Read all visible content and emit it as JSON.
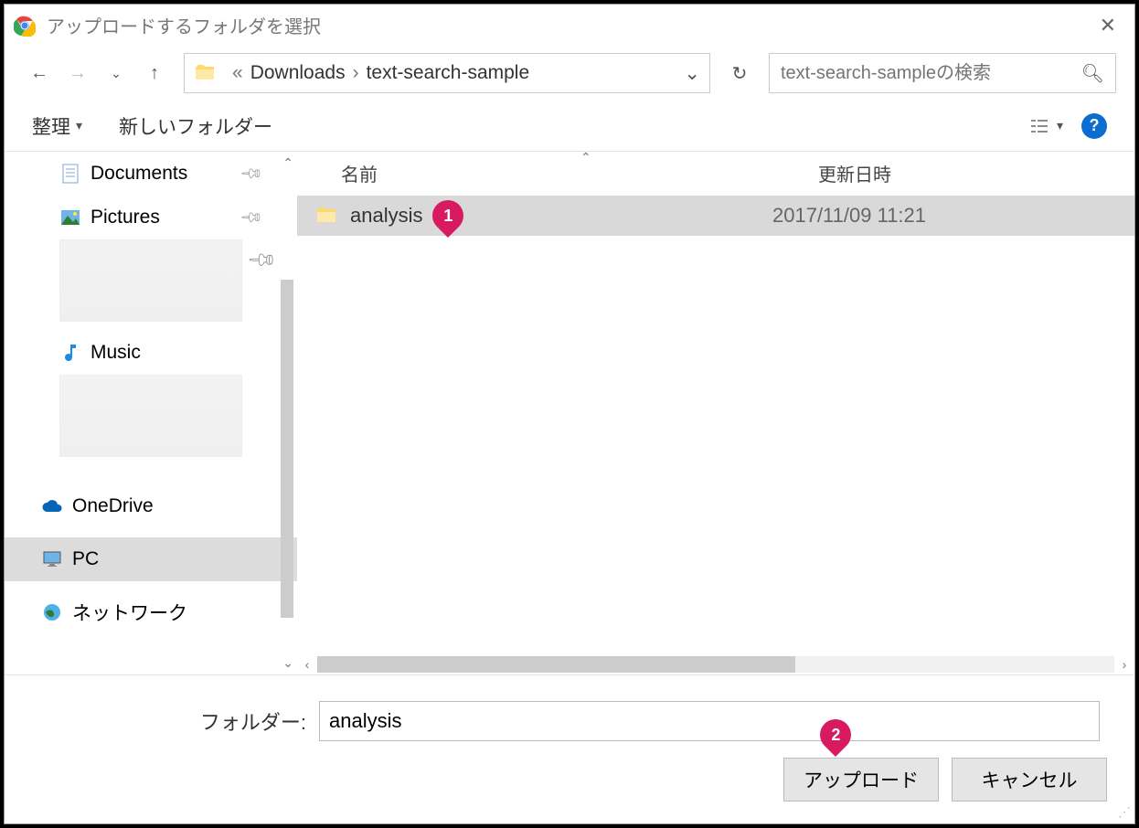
{
  "title": "アップロードするフォルダを選択",
  "breadcrumb": {
    "prefix": "«",
    "item1": "Downloads",
    "item2": "text-search-sample"
  },
  "search": {
    "placeholder": "text-search-sampleの検索"
  },
  "toolbar": {
    "organize": "整理",
    "newfolder": "新しいフォルダー"
  },
  "headers": {
    "name": "名前",
    "date": "更新日時"
  },
  "sidebar": {
    "documents": "Documents",
    "pictures": "Pictures",
    "music": "Music",
    "onedrive": "OneDrive",
    "pc": "PC",
    "network": "ネットワーク"
  },
  "files": [
    {
      "name": "analysis",
      "date": "2017/11/09 11:21"
    }
  ],
  "footer": {
    "label": "フォルダー:",
    "value": "analysis",
    "upload": "アップロード",
    "cancel": "キャンセル"
  },
  "badges": {
    "b1": "1",
    "b2": "2"
  }
}
